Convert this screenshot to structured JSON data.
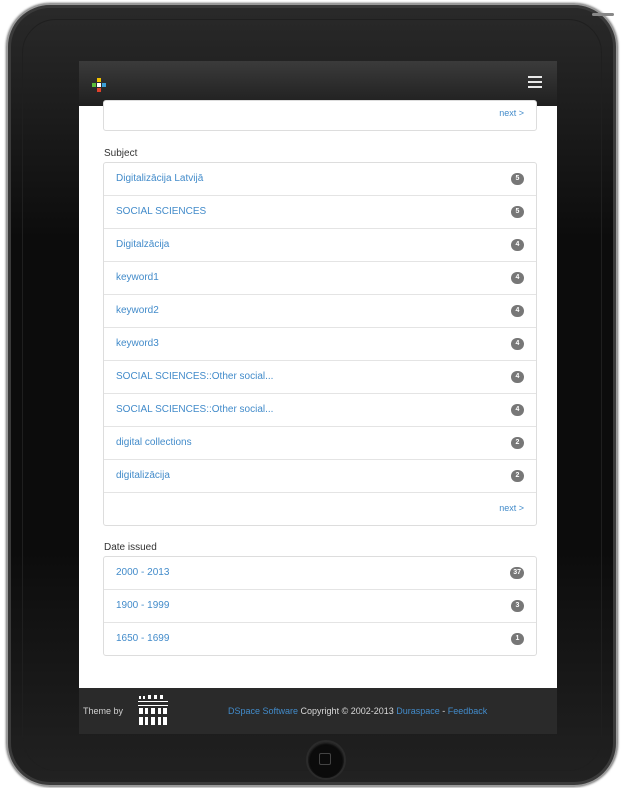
{
  "header": {
    "logo_icon": "dspace-logo-icon",
    "menu_icon": "hamburger-menu-icon"
  },
  "top_panel": {
    "next_label": "next >"
  },
  "subject": {
    "title": "Subject",
    "items": [
      {
        "label": "Digitalizācija Latvijā",
        "count": "5"
      },
      {
        "label": "SOCIAL SCIENCES",
        "count": "5"
      },
      {
        "label": "Digitalzācija",
        "count": "4"
      },
      {
        "label": "keyword1",
        "count": "4"
      },
      {
        "label": "keyword2",
        "count": "4"
      },
      {
        "label": "keyword3",
        "count": "4"
      },
      {
        "label": "SOCIAL SCIENCES::Other social...",
        "count": "4"
      },
      {
        "label": "SOCIAL SCIENCES::Other social...",
        "count": "4"
      },
      {
        "label": "digital collections",
        "count": "2"
      },
      {
        "label": "digitalizācija",
        "count": "2"
      }
    ],
    "next_label": "next >"
  },
  "date_issued": {
    "title": "Date issued",
    "items": [
      {
        "label": "2000 - 2013",
        "count": "37"
      },
      {
        "label": "1900 - 1999",
        "count": "3"
      },
      {
        "label": "1650 - 1699",
        "count": "1"
      }
    ]
  },
  "footer": {
    "theme_by": "Theme by",
    "cineca_logo": "cineca-logo-icon",
    "dspace_link": "DSpace Software",
    "copyright": " Copyright © 2002-2013 ",
    "duraspace_link": "Duraspace",
    "separator": " - ",
    "feedback_link": "Feedback"
  },
  "colors": {
    "link": "#428bca",
    "badge": "#777777",
    "navbar": "#2a2a2a"
  }
}
